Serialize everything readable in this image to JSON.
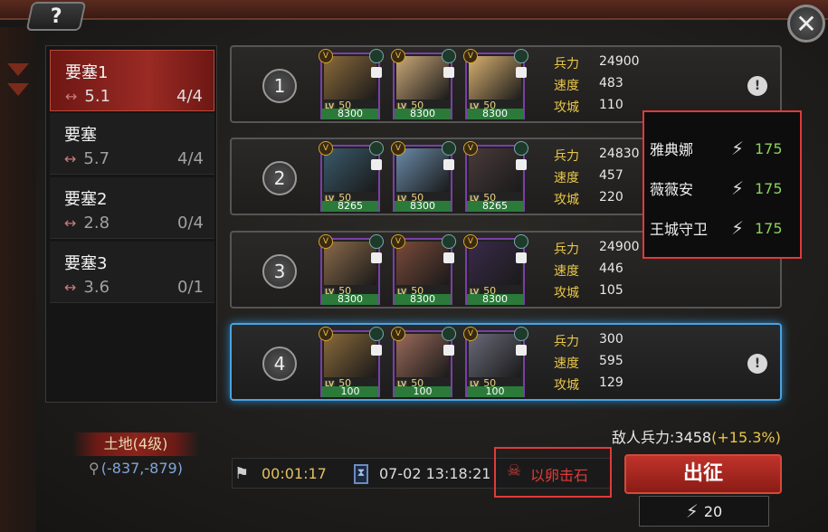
{
  "help_label": "?",
  "close_label": "✕",
  "sidebar": {
    "items": [
      {
        "name": "要塞1",
        "distance": "5.1",
        "count": "4/4"
      },
      {
        "name": "要塞",
        "distance": "5.7",
        "count": "4/4"
      },
      {
        "name": "要塞2",
        "distance": "2.8",
        "count": "0/4"
      },
      {
        "name": "要塞3",
        "distance": "3.6",
        "count": "0/1"
      }
    ]
  },
  "land": {
    "name": "土地(4级)",
    "coords": "(-837,-879)"
  },
  "stat_labels": {
    "power": "兵力",
    "speed": "速度",
    "siege": "攻城"
  },
  "teams": [
    {
      "number": "1",
      "power": "24900",
      "speed": "483",
      "siege": "110",
      "heroes": [
        {
          "level": "50",
          "troops": "8300"
        },
        {
          "level": "50",
          "troops": "8300"
        },
        {
          "level": "50",
          "troops": "8300"
        }
      ]
    },
    {
      "number": "2",
      "power": "24830",
      "speed": "457",
      "siege": "220",
      "heroes": [
        {
          "level": "50",
          "troops": "8265"
        },
        {
          "level": "50",
          "troops": "8300"
        },
        {
          "level": "50",
          "troops": "8265"
        }
      ]
    },
    {
      "number": "3",
      "power": "24900",
      "speed": "446",
      "siege": "105",
      "heroes": [
        {
          "level": "50",
          "troops": "8300"
        },
        {
          "level": "50",
          "troops": "8300"
        },
        {
          "level": "50",
          "troops": "8300"
        }
      ]
    },
    {
      "number": "4",
      "power": "300",
      "speed": "595",
      "siege": "129",
      "heroes": [
        {
          "level": "50",
          "troops": "100"
        },
        {
          "level": "50",
          "troops": "100"
        },
        {
          "level": "50",
          "troops": "100"
        }
      ]
    }
  ],
  "lv_tag": "LV",
  "info_label": "!",
  "popup": {
    "rows": [
      {
        "name": "雅典娜",
        "value": "175"
      },
      {
        "name": "薇薇安",
        "value": "175"
      },
      {
        "name": "王城守卫",
        "value": "175"
      }
    ]
  },
  "bottom": {
    "march_time": "00:01:17",
    "arrival": "07-02 13:18:21",
    "warning": "以卵击石",
    "enemy_label": "敌人兵力:3458",
    "enemy_pct": "(+15.3%)",
    "march_button": "出征",
    "stamina_cost": "20"
  }
}
